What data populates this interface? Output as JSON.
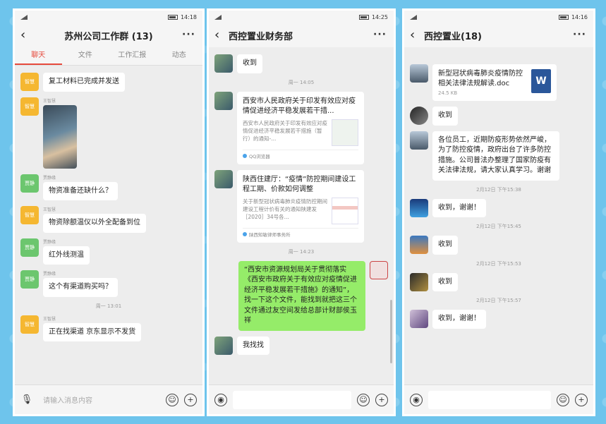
{
  "status": {
    "time1": "14:18",
    "time2": "14:25",
    "time3": "14:16"
  },
  "panel1": {
    "title": "苏州公司工作群 (13)",
    "tabs": [
      "聊天",
      "文件",
      "工作汇报",
      "动态"
    ],
    "messages": [
      {
        "avatar_label": "智慧",
        "sender": "",
        "text": "复工材料已完成并发送"
      },
      {
        "avatar_label": "智慧",
        "sender": "王智慧",
        "text": ""
      },
      {
        "avatar_label": "贾静",
        "sender": "贾静缘",
        "text": "物资准备还缺什么？"
      },
      {
        "avatar_label": "智慧",
        "sender": "王智慧",
        "text": "物资除额温仪以外全配备到位"
      },
      {
        "avatar_label": "贾静",
        "sender": "贾静缘",
        "text": "红外线测温"
      },
      {
        "avatar_label": "贾静",
        "sender": "贾静缘",
        "text": "这个有渠道购买吗？"
      },
      {
        "avatar_label": "智慧",
        "sender": "王智慧",
        "text": "正在找渠道 京东显示不发货"
      }
    ],
    "timestamp": "周一 13:01",
    "input_placeholder": "请输入消息内容"
  },
  "panel2": {
    "title": "西控置业财务部",
    "msg_received": "收到",
    "ts1": "周一 14:05",
    "card1": {
      "title": "西安市人民政府关于印发有效应对疫情促进经济平稳发展若干措...",
      "desc": "西安市人民政府关于印发有效应对疫情促进经济平稳发展若干措施（暂行）的通知-...",
      "source": "QQ浏览器"
    },
    "card2": {
      "title": "陕西住建厅：“疫情”防控期间建设工程工期、价款如何调整",
      "desc": "关于新型冠状病毒肺炎疫情防控期间建设工程计价有关的通知陕建发［2020］34号各...",
      "source": "陕西知敏律师事务所"
    },
    "ts2": "周一 14:23",
    "my_msg": "“西安市资源规划局关于贯彻落实《西安市政府关于有效应对疫情促进经济平稳发展若干措施》的通知”，找一下这个文件，能找到就把这三个文件通过友空间发给总部计财部侯玉祥",
    "reply": "我找找"
  },
  "panel3": {
    "title": "西控置业(18)",
    "file_name": "新型冠状病毒肺炎疫情防控相关法律法规解读.doc",
    "file_size": "24.5 KB",
    "word_letter": "W",
    "msg_received": "收到",
    "notice": "各位员工，近期防疫形势依然严峻，为了防控疫情，政府出台了许多防控措施。公司普法办整理了国家防疫有关法律法规，请大家认真学习。谢谢",
    "ts1": "2月12日 下午15:38",
    "m1": "收到，谢谢！",
    "ts2": "2月12日 下午15:45",
    "m2": "收到",
    "ts3": "2月12日 下午15:53",
    "m3": "收到",
    "ts4": "2月12日 下午15:57",
    "m4": "收到，谢谢！"
  }
}
